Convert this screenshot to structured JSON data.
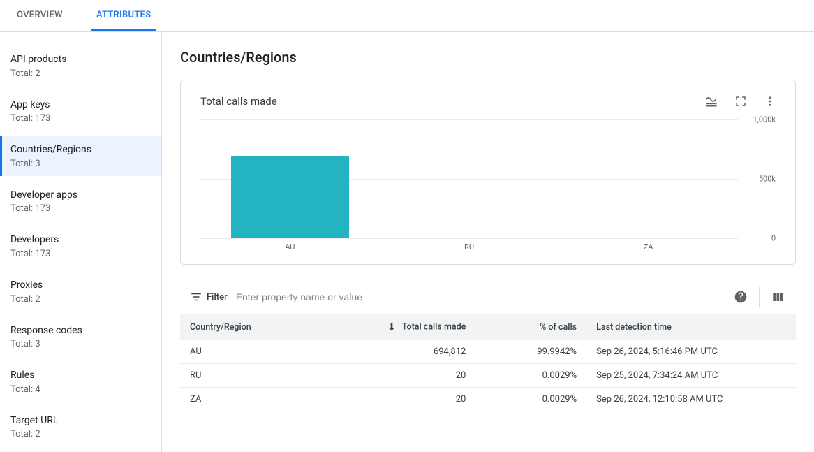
{
  "tabs": {
    "overview": "OVERVIEW",
    "attributes": "ATTRIBUTES"
  },
  "sidebar": {
    "total_prefix": "Total: ",
    "items": [
      {
        "label": "API products",
        "total": "2"
      },
      {
        "label": "App keys",
        "total": "173"
      },
      {
        "label": "Countries/Regions",
        "total": "3"
      },
      {
        "label": "Developer apps",
        "total": "173"
      },
      {
        "label": "Developers",
        "total": "173"
      },
      {
        "label": "Proxies",
        "total": "2"
      },
      {
        "label": "Response codes",
        "total": "3"
      },
      {
        "label": "Rules",
        "total": "4"
      },
      {
        "label": "Target URL",
        "total": "2"
      }
    ]
  },
  "page": {
    "title": "Countries/Regions"
  },
  "chart_card": {
    "title": "Total calls made"
  },
  "chart_data": {
    "type": "bar",
    "categories": [
      "AU",
      "RU",
      "ZA"
    ],
    "values": [
      694812,
      20,
      20
    ],
    "yticks": [
      {
        "v": 1000000,
        "label": "1,000k"
      },
      {
        "v": 500000,
        "label": "500k"
      },
      {
        "v": 0,
        "label": "0"
      }
    ],
    "ymax": 1000000,
    "color": "#24b3c1"
  },
  "filter": {
    "label": "Filter",
    "placeholder": "Enter property name or value"
  },
  "table": {
    "columns": {
      "country": "Country/Region",
      "calls": "Total calls made",
      "pct": "% of calls",
      "last": "Last detection time"
    },
    "rows": [
      {
        "country": "AU",
        "calls": "694,812",
        "pct": "99.9942%",
        "last": "Sep 26, 2024, 5:16:46 PM UTC"
      },
      {
        "country": "RU",
        "calls": "20",
        "pct": "0.0029%",
        "last": "Sep 25, 2024, 7:34:24 AM UTC"
      },
      {
        "country": "ZA",
        "calls": "20",
        "pct": "0.0029%",
        "last": "Sep 26, 2024, 12:10:58 AM UTC"
      }
    ]
  }
}
